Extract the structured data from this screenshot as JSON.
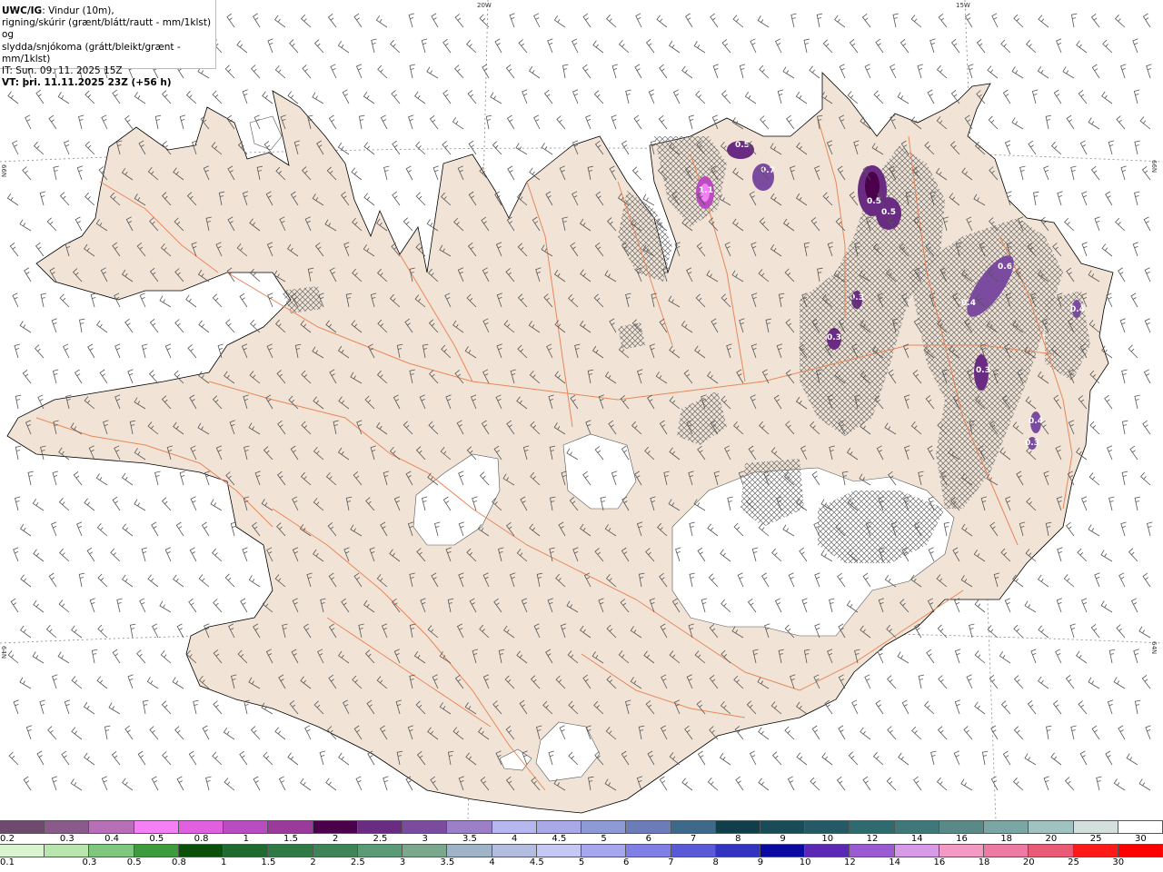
{
  "title": {
    "product": "UWC/IG",
    "line1": ": Vindur (10m),",
    "line2": "rigning/skúrir (grænt/blátt/rautt - mm/1klst) og",
    "line3": "slydda/snjókoma (grátt/bleikt/grænt - mm/1klst)",
    "issue_time": "IT: Sun. 09. 11. 2025 15Z",
    "valid_time": "VT: þri. 11.11.2025 23Z (+56 h)"
  },
  "graticule": {
    "lon_labels": [
      "20W",
      "15W"
    ],
    "lat_labels_left": [
      "66N",
      "64N"
    ],
    "lat_labels_right": [
      "66N",
      "64N"
    ]
  },
  "precip_labels": [
    "1.1",
    "0.5",
    "0.7",
    "0.5",
    "0.5",
    "0.4",
    "0.6",
    "0.3",
    "0.3",
    "0.3",
    "0.4",
    "0.3",
    "0.4"
  ],
  "colors": {
    "land": "#f1e4d6",
    "glacier": "#ffffff",
    "roads": "#e8875a",
    "coast": "#000000"
  },
  "legend_snow": {
    "ticks": [
      "0.2",
      "0.3",
      "0.4",
      "0.5",
      "0.8",
      "1",
      "1.5",
      "2",
      "2.5",
      "3",
      "3.5",
      "4",
      "4.5",
      "5",
      "6",
      "7",
      "8",
      "9",
      "10",
      "12",
      "14",
      "16",
      "18",
      "20",
      "25",
      "30"
    ],
    "colors": [
      "#6e4a6e",
      "#8a5a8a",
      "#b76fb7",
      "#f57ff5",
      "#e060e0",
      "#b94cc0",
      "#9a3a9a",
      "#4a004a",
      "#6a2b82",
      "#7b4ba0",
      "#9b7fc7",
      "#b7b7f0",
      "#a9a9e8",
      "#8e9ad6",
      "#6b7cb8",
      "#3d6a8a",
      "#103e4a",
      "#1a4c58",
      "#245a66",
      "#2f6a6f",
      "#3f7878",
      "#5a8a88",
      "#7aa6a4",
      "#a0c2c0",
      "#d4e0de",
      "#ffffff"
    ]
  },
  "legend_rain": {
    "ticks": [
      "0.1",
      "0.3",
      "0.5",
      "0.8",
      "1",
      "1.5",
      "2",
      "2.5",
      "3",
      "3.5",
      "4",
      "4.5",
      "5",
      "6",
      "7",
      "8",
      "9",
      "10",
      "12",
      "14",
      "16",
      "18",
      "20",
      "25",
      "30"
    ],
    "colors": [
      "#d8f5d0",
      "#b9e6ad",
      "#7fc77f",
      "#3d9a3d",
      "#0a4f0a",
      "#1f6a2e",
      "#2f7a44",
      "#3e8457",
      "#5a9a76",
      "#7aa88c",
      "#a0b4c8",
      "#b3bde0",
      "#c4c8f2",
      "#a7a7ef",
      "#7f7fe6",
      "#5a5ad8",
      "#3333c2",
      "#0a0aa0",
      "#5a28b4",
      "#9a5ad2",
      "#d79ae8",
      "#f29ac4",
      "#ec7aa2",
      "#e85a76",
      "#ff1a1a",
      "#ff0000"
    ]
  }
}
